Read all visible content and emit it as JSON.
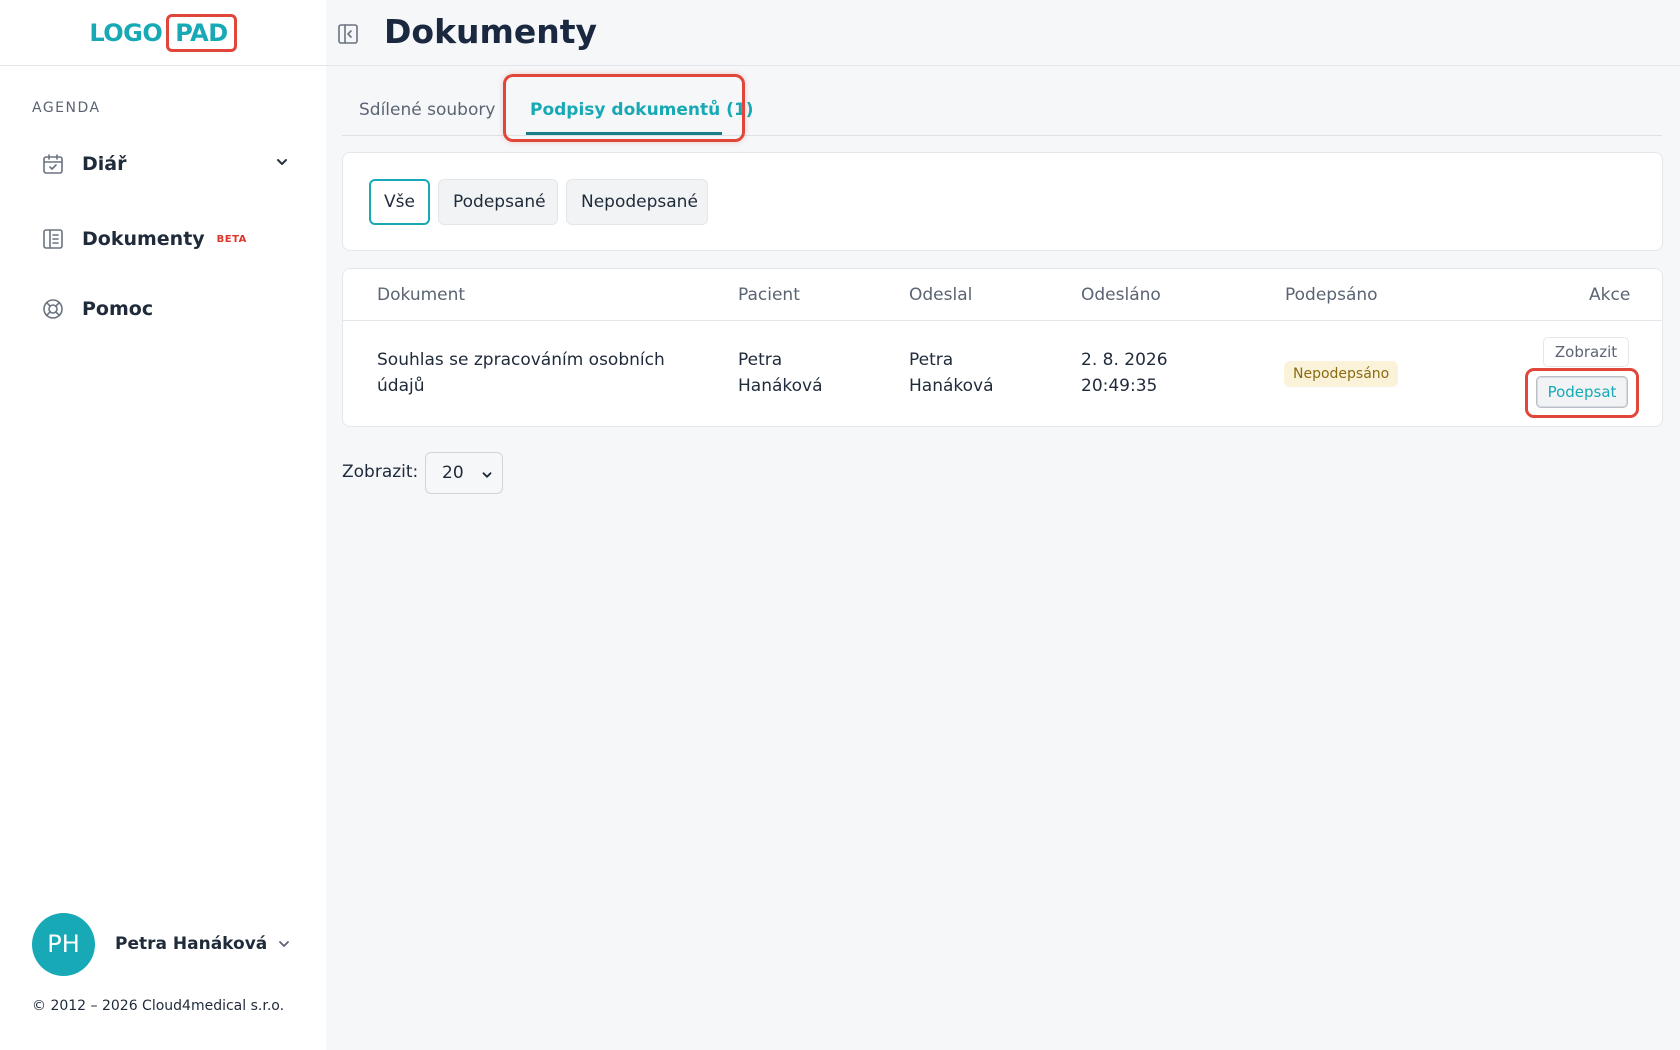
{
  "logo": {
    "part1": "LOGO",
    "part2": "PAD"
  },
  "sidebar": {
    "section_title": "AGENDA",
    "items": [
      {
        "label": "Diář",
        "icon": "calendar-check-icon"
      },
      {
        "label": "Dokumenty",
        "badge": "BETA",
        "icon": "document-list-icon"
      },
      {
        "label": "Pomoc",
        "icon": "lifebuoy-icon"
      }
    ],
    "user": {
      "initials": "PH",
      "name": "Petra Hanáková"
    },
    "copyright": "© 2012 – 2026 Cloud4medical s.r.o."
  },
  "header": {
    "title": "Dokumenty"
  },
  "tabs": [
    {
      "label": "Sdílené soubory",
      "active": false
    },
    {
      "label": "Podpisy dokumentů (1)",
      "active": true
    }
  ],
  "filters": [
    {
      "label": "Vše",
      "active": true
    },
    {
      "label": "Podepsané",
      "active": false
    },
    {
      "label": "Nepodepsané",
      "active": false
    }
  ],
  "table": {
    "columns": [
      "Dokument",
      "Pacient",
      "Odeslal",
      "Odesláno",
      "Podepsáno",
      "Akce"
    ],
    "rows": [
      {
        "document_line1": "Souhlas se zpracováním osobních",
        "document_line2": "údajů",
        "patient_line1": "Petra",
        "patient_line2": "Hanáková",
        "sender_line1": "Petra",
        "sender_line2": "Hanáková",
        "sent_date": "2. 8. 2026",
        "sent_time": "20:49:35",
        "status": "Nepodepsáno",
        "action_view": "Zobrazit",
        "action_sign": "Podepsat"
      }
    ]
  },
  "page_size": {
    "label": "Zobrazit:",
    "value": "20"
  },
  "colors": {
    "accent": "#17a9b5",
    "highlight": "#e0463a",
    "beta": "#e0342a",
    "status_bg": "#fbf3d9"
  }
}
